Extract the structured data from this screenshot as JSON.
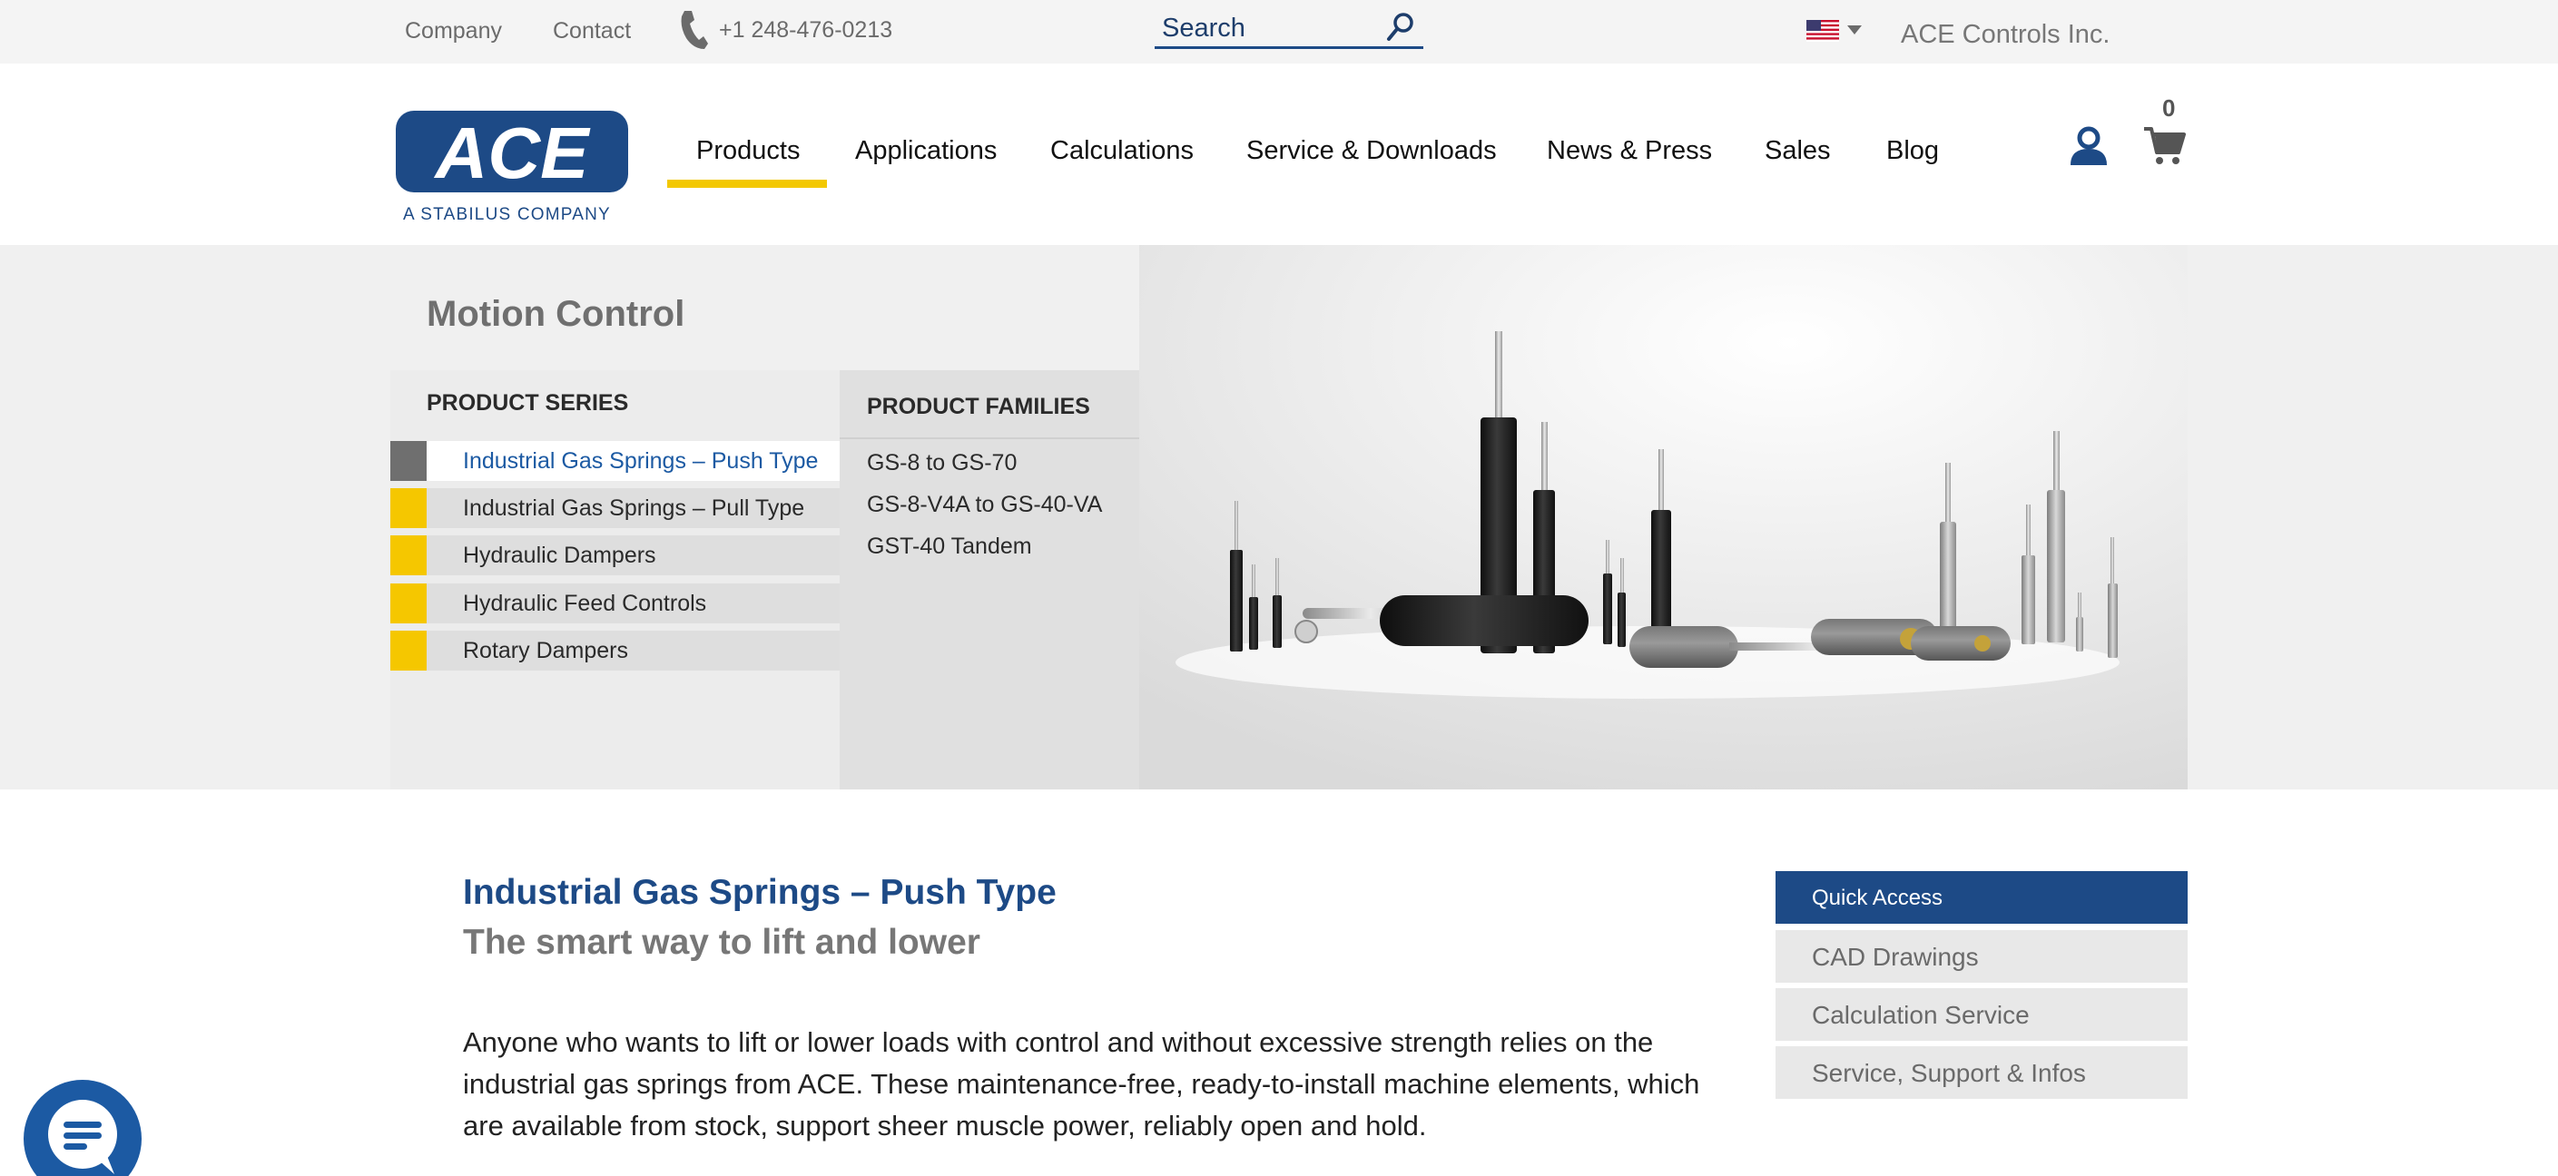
{
  "topbar": {
    "company_link": "Company",
    "contact_link": "Contact",
    "phone": "+1 248-476-0213",
    "search_placeholder": "Search",
    "company_name": "ACE Controls Inc.",
    "region_flag": "us-flag-icon"
  },
  "logo": {
    "wordmark": "ACE",
    "tagline": "A STABILUS COMPANY"
  },
  "nav": {
    "items": [
      {
        "label": "Products",
        "active": true
      },
      {
        "label": "Applications"
      },
      {
        "label": "Calculations"
      },
      {
        "label": "Service & Downloads"
      },
      {
        "label": "News & Press"
      },
      {
        "label": "Sales"
      },
      {
        "label": "Blog"
      }
    ],
    "cart_count": "0"
  },
  "mega_menu": {
    "title": "Motion Control",
    "series_heading": "PRODUCT SERIES",
    "series": [
      {
        "label": "Industrial Gas Springs – Push Type",
        "active": true
      },
      {
        "label": "Industrial Gas Springs – Pull Type"
      },
      {
        "label": "Hydraulic Dampers"
      },
      {
        "label": "Hydraulic Feed Controls"
      },
      {
        "label": "Rotary Dampers"
      }
    ],
    "families_heading": "PRODUCT FAMILIES",
    "families": [
      "GS-8 to GS-70",
      "GS-8-V4A to GS-40-VA",
      "GST-40 Tandem"
    ]
  },
  "content": {
    "title": "Industrial Gas Springs – Push Type",
    "subtitle": "The smart way to lift and lower",
    "body": "Anyone who wants to lift or lower loads with control and without excessive strength relies on the industrial gas springs from ACE. These maintenance-free, ready-to-install machine elements, which are available from stock, support sheer muscle power, reliably open and hold."
  },
  "quick_access": {
    "heading": "Quick Access",
    "items": [
      "CAD Drawings",
      "Calculation Service",
      "Service, Support & Infos"
    ]
  },
  "colors": {
    "brand_blue": "#1d4a86",
    "accent_yellow": "#f3c800",
    "link_blue": "#1c5aa3"
  }
}
